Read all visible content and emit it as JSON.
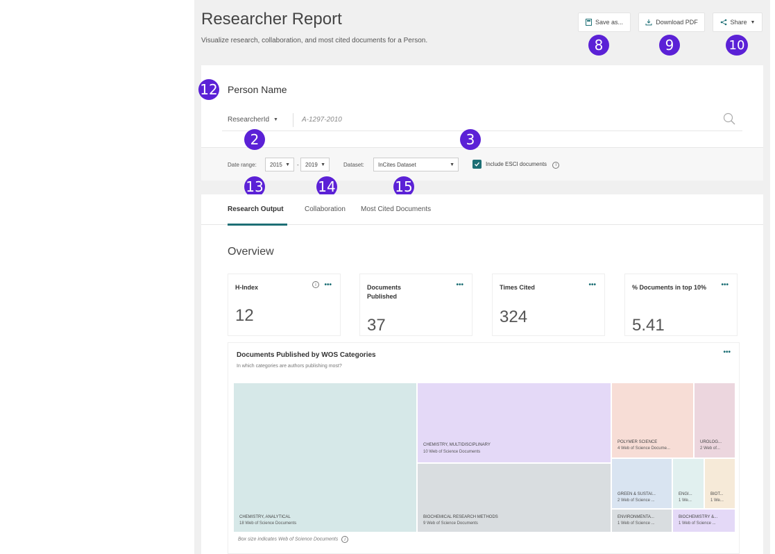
{
  "header": {
    "title": "Researcher Report",
    "subtitle": "Visualize research, collaboration, and most cited documents for a Person."
  },
  "toolbar": {
    "save_label": "Save as...",
    "download_label": "Download PDF",
    "share_label": "Share"
  },
  "badges": {
    "b8": "8",
    "b9": "9",
    "b10": "10",
    "b12": "12",
    "b2": "2",
    "b3": "3",
    "b13": "13",
    "b14": "14",
    "b15": "15"
  },
  "search": {
    "person_label": "Person Name",
    "id_type": "ResearcherId",
    "id_value": "A-1297-2010"
  },
  "filters": {
    "date_range_label": "Date range:",
    "date_from": "2015",
    "date_sep": "-",
    "date_to": "2019",
    "dataset_label": "Dataset:",
    "dataset_value": "InCites Dataset",
    "include_esci_label": "Include ESCI documents",
    "include_esci_checked": true
  },
  "tabs": [
    {
      "label": "Research Output",
      "active": true
    },
    {
      "label": "Collaboration",
      "active": false
    },
    {
      "label": "Most Cited Documents",
      "active": false
    }
  ],
  "overview": {
    "title": "Overview",
    "metrics": [
      {
        "label": "H-Index",
        "value": "12"
      },
      {
        "label": "Documents Published",
        "value": "37"
      },
      {
        "label": "Times Cited",
        "value": "324"
      },
      {
        "label": "% Documents in top 10%",
        "value": "5.41"
      }
    ]
  },
  "treemap": {
    "title": "Documents Published by WOS Categories",
    "subtitle": "In which categories are authors publishing most?",
    "footnote": "Box size indicates Web of Science Documents",
    "tiles": [
      {
        "name": "CHEMISTRY, ANALYTICAL",
        "sub": "18 Web of Science Documents",
        "color": "#d6e8e8"
      },
      {
        "name": "CHEMISTRY, MULTIDISCIPLINARY",
        "sub": "10 Web of Science Documents",
        "color": "#e4d9f7"
      },
      {
        "name": "BIOCHEMICAL RESEARCH METHODS",
        "sub": "9 Web of Science Documents",
        "color": "#d9dde0"
      },
      {
        "name": "POLYMER SCIENCE",
        "sub": "4 Web of Science Docume...",
        "color": "#f7ddd6"
      },
      {
        "name": "UROLOG...",
        "sub": "2 Web of...",
        "color": "#ecd6de"
      },
      {
        "name": "GREEN & SUSTAI...",
        "sub": "2 Web of Science ...",
        "color": "#d9e4f1"
      },
      {
        "name": "ENGI...",
        "sub": "1 We...",
        "color": "#e1f0ef"
      },
      {
        "name": "BIOT...",
        "sub": "1 We...",
        "color": "#f6ead8"
      },
      {
        "name": "ENVIRONMENTA...",
        "sub": "1 Web of Science ...",
        "color": "#d9dde0"
      },
      {
        "name": "BIOCHEMISTRY &...",
        "sub": "1 Web of Science ...",
        "color": "#e4d9f7"
      }
    ]
  },
  "icons": {
    "save": "save-icon",
    "download": "download-icon",
    "share": "share-icon",
    "search": "search-icon",
    "info": "info-icon",
    "more": "more-dots-icon"
  },
  "colors": {
    "accent": "#1d6f75",
    "badge": "#5b21d6"
  }
}
